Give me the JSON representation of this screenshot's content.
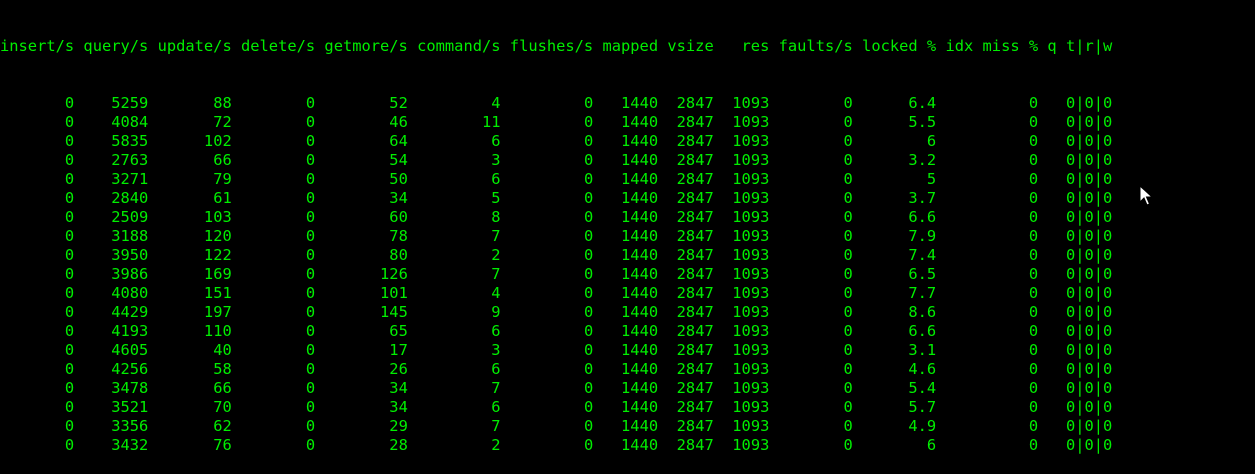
{
  "terminal": {
    "headers": [
      "insert/s",
      "query/s",
      "update/s",
      "delete/s",
      "getmore/s",
      "command/s",
      "flushes/s",
      "mapped",
      "vsize",
      "res",
      "faults/s",
      "locked %",
      "idx miss %",
      "q t|r|w"
    ],
    "rows": [
      [
        "0",
        "5259",
        "88",
        "0",
        "52",
        "4",
        "0",
        "1440",
        "2847",
        "1093",
        "0",
        "6.4",
        "0",
        "0|0|0"
      ],
      [
        "0",
        "4084",
        "72",
        "0",
        "46",
        "11",
        "0",
        "1440",
        "2847",
        "1093",
        "0",
        "5.5",
        "0",
        "0|0|0"
      ],
      [
        "0",
        "5835",
        "102",
        "0",
        "64",
        "6",
        "0",
        "1440",
        "2847",
        "1093",
        "0",
        "6",
        "0",
        "0|0|0"
      ],
      [
        "0",
        "2763",
        "66",
        "0",
        "54",
        "3",
        "0",
        "1440",
        "2847",
        "1093",
        "0",
        "3.2",
        "0",
        "0|0|0"
      ],
      [
        "0",
        "3271",
        "79",
        "0",
        "50",
        "6",
        "0",
        "1440",
        "2847",
        "1093",
        "0",
        "5",
        "0",
        "0|0|0"
      ],
      [
        "0",
        "2840",
        "61",
        "0",
        "34",
        "5",
        "0",
        "1440",
        "2847",
        "1093",
        "0",
        "3.7",
        "0",
        "0|0|0"
      ],
      [
        "0",
        "2509",
        "103",
        "0",
        "60",
        "8",
        "0",
        "1440",
        "2847",
        "1093",
        "0",
        "6.6",
        "0",
        "0|0|0"
      ],
      [
        "0",
        "3188",
        "120",
        "0",
        "78",
        "7",
        "0",
        "1440",
        "2847",
        "1093",
        "0",
        "7.9",
        "0",
        "0|0|0"
      ],
      [
        "0",
        "3950",
        "122",
        "0",
        "80",
        "2",
        "0",
        "1440",
        "2847",
        "1093",
        "0",
        "7.4",
        "0",
        "0|0|0"
      ],
      [
        "0",
        "3986",
        "169",
        "0",
        "126",
        "7",
        "0",
        "1440",
        "2847",
        "1093",
        "0",
        "6.5",
        "0",
        "0|0|0"
      ],
      [
        "0",
        "4080",
        "151",
        "0",
        "101",
        "4",
        "0",
        "1440",
        "2847",
        "1093",
        "0",
        "7.7",
        "0",
        "0|0|0"
      ],
      [
        "0",
        "4429",
        "197",
        "0",
        "145",
        "9",
        "0",
        "1440",
        "2847",
        "1093",
        "0",
        "8.6",
        "0",
        "0|0|0"
      ],
      [
        "0",
        "4193",
        "110",
        "0",
        "65",
        "6",
        "0",
        "1440",
        "2847",
        "1093",
        "0",
        "6.6",
        "0",
        "0|0|0"
      ],
      [
        "0",
        "4605",
        "40",
        "0",
        "17",
        "3",
        "0",
        "1440",
        "2847",
        "1093",
        "0",
        "3.1",
        "0",
        "0|0|0"
      ],
      [
        "0",
        "4256",
        "58",
        "0",
        "26",
        "6",
        "0",
        "1440",
        "2847",
        "1093",
        "0",
        "4.6",
        "0",
        "0|0|0"
      ],
      [
        "0",
        "3478",
        "66",
        "0",
        "34",
        "7",
        "0",
        "1440",
        "2847",
        "1093",
        "0",
        "5.4",
        "0",
        "0|0|0"
      ],
      [
        "0",
        "3521",
        "70",
        "0",
        "34",
        "6",
        "0",
        "1440",
        "2847",
        "1093",
        "0",
        "5.7",
        "0",
        "0|0|0"
      ],
      [
        "0",
        "3356",
        "62",
        "0",
        "29",
        "7",
        "0",
        "1440",
        "2847",
        "1093",
        "0",
        "4.9",
        "0",
        "0|0|0"
      ],
      [
        "0",
        "3432",
        "76",
        "0",
        "28",
        "2",
        "0",
        "1440",
        "2847",
        "1093",
        "0",
        "6",
        "0",
        "0|0|0"
      ]
    ],
    "colors": {
      "background": "#000000",
      "text": "#00ee00"
    }
  },
  "cursor": {
    "icon": "mouse-pointer-icon"
  }
}
